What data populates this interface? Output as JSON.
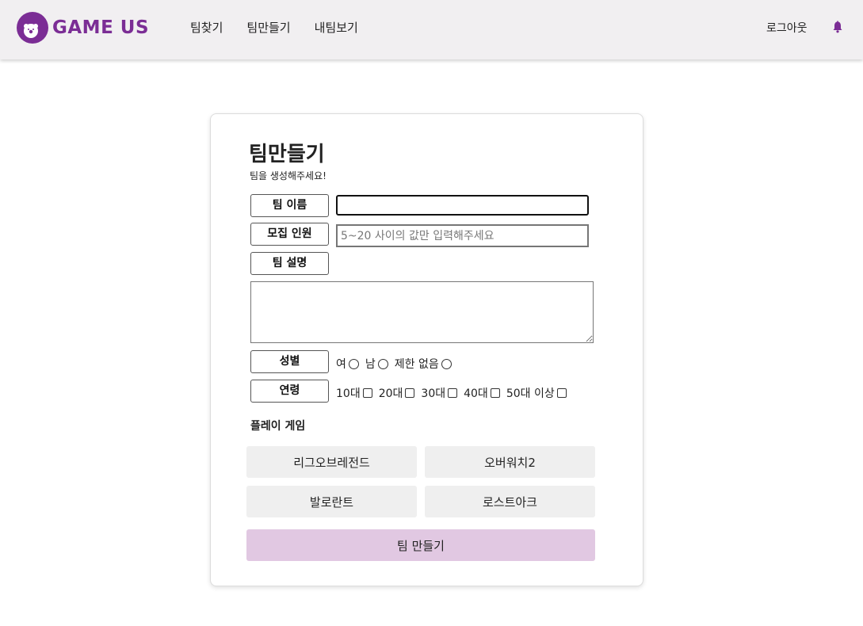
{
  "brand": {
    "name": "GAME US",
    "color": "#7b2d95"
  },
  "nav": {
    "items": [
      "팀찾기",
      "팀만들기",
      "내팀보기"
    ],
    "logout": "로그아웃"
  },
  "form": {
    "title": "팀만들기",
    "subtitle": "팀을 생성해주세요!",
    "team_name": {
      "label": "팀 이름",
      "value": ""
    },
    "recruit": {
      "label": "모집 인원",
      "value": "",
      "placeholder": "5~20 사이의 값만 입력해주세요"
    },
    "description": {
      "label": "팀 설명",
      "value": ""
    },
    "gender": {
      "label": "성별",
      "options": [
        "여",
        "남",
        "제한 없음"
      ]
    },
    "age": {
      "label": "연령",
      "options": [
        "10대",
        "20대",
        "30대",
        "40대",
        "50대 이상"
      ]
    },
    "play_game": {
      "label": "플레이 게임",
      "games": [
        "리그오브레전드",
        "오버워치2",
        "발로란트",
        "로스트아크"
      ]
    },
    "submit": "팀 만들기"
  },
  "colors": {
    "header_bg": "#f1eff1",
    "submit_bg": "#e1c8e2",
    "game_button_bg": "#efefef"
  }
}
